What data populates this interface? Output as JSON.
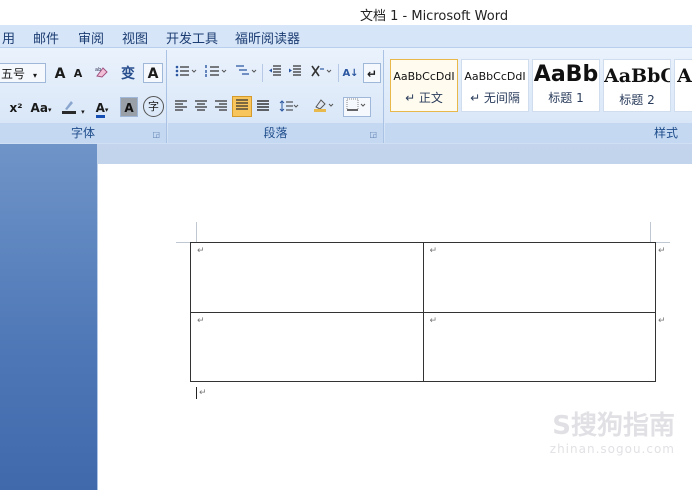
{
  "window": {
    "title": "文档 1 - Microsoft Word"
  },
  "tabs": [
    "用",
    "邮件",
    "审阅",
    "视图",
    "开发工具",
    "福昕阅读器"
  ],
  "ribbon": {
    "font_group": {
      "label": "字体",
      "font_size": "五号",
      "grow_label": "A",
      "shrink_label": "A",
      "phonetic_label": "变",
      "border_char_label": "A",
      "superscript_label": "x²",
      "change_case_label": "Aa",
      "font_color_label": "A",
      "shading_label": "A",
      "enclose_label": "字"
    },
    "paragraph_group": {
      "label": "段落",
      "sort_label": "A↓",
      "marks_label": "↵"
    },
    "styles_group": {
      "label": "样式",
      "items": [
        {
          "sample": "AaBbCcDdI",
          "name": "↵ 正文"
        },
        {
          "sample": "AaBbCcDdI",
          "name": "↵ 无间隔"
        },
        {
          "sample": "AaBb",
          "name": "标题 1"
        },
        {
          "sample": "AaBbC",
          "name": "标题 2"
        },
        {
          "sample": "A",
          "name": ""
        }
      ]
    }
  },
  "document": {
    "cell_mark": "↵",
    "table": [
      [
        "↵",
        "↵"
      ],
      [
        "↵",
        "↵"
      ]
    ]
  },
  "watermark": {
    "line1": "S搜狗指南",
    "line2": "zhinan.sogou.com"
  }
}
